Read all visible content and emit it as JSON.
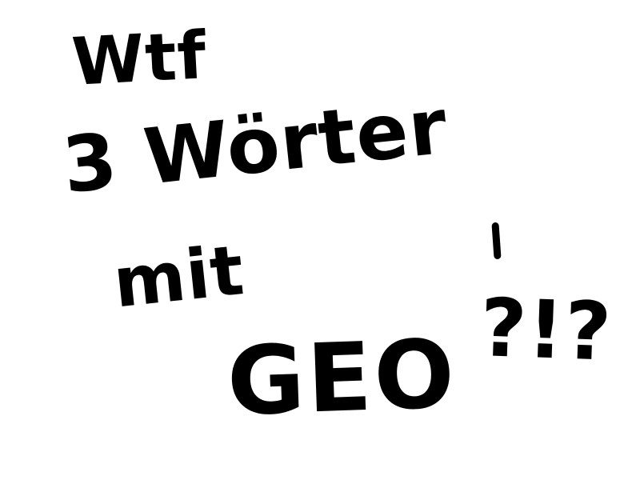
{
  "scribble": {
    "line1": "Wtf",
    "line2": "3 Wörter",
    "line3": "mit",
    "line4": "GEO",
    "line5": "?!?"
  },
  "colors": {
    "background": "#ffffff",
    "ink": "#000000"
  }
}
